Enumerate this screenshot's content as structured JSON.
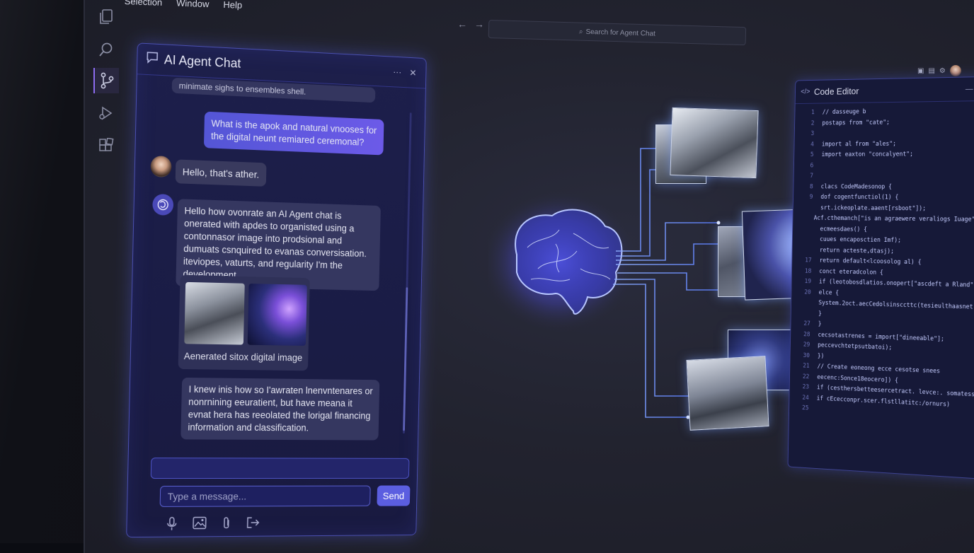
{
  "menubar": {
    "items": [
      "Selection",
      "Window",
      "Help"
    ]
  },
  "search": {
    "placeholder": "Search for Agent Chat"
  },
  "activity_bar": {
    "items": [
      "explorer",
      "search",
      "source-control",
      "run-debug",
      "extensions"
    ]
  },
  "chat": {
    "title": "AI Agent Chat",
    "header_more": "···",
    "header_close": "✕",
    "messages": {
      "cut_top": "minimate sighs to ensembles shell.",
      "user": "What is the apok and natural vnooses for the digital neunt remiared ceremonal?",
      "hello": "Hello, that's ather.",
      "ai1": "Hello how ovonrate an AI Agent chat is onerated with apdes to organisted using a contonnasor image into prodsional and dumuats csnquired to evanas conversisation. iteviopes, vaturts, and regularity I'm the development.",
      "image_caption": "Aenerated sitox digital image",
      "ai2": "I knew inis how so I'awraten lnenvntenares or nonrnining eeuratient, but have meana it evnat hera has reeolated the lorigal financing information and classification."
    },
    "composer": {
      "placeholder": "Type a message...",
      "send_label": "Send",
      "tools": [
        "microphone-icon",
        "image-icon",
        "paperclip-icon",
        "export-icon"
      ]
    }
  },
  "editor": {
    "title": "Code Editor",
    "close": "— ✕",
    "lines": [
      {
        "n": "1",
        "t": "// dasseuge b"
      },
      {
        "n": "2",
        "t": "postaps from \"cate\";"
      },
      {
        "n": "3",
        "t": ""
      },
      {
        "n": "4",
        "t": "import al from \"ales\";"
      },
      {
        "n": "5",
        "t": "import eaxton \"concalyent\";"
      },
      {
        "n": "6",
        "t": ""
      },
      {
        "n": "7",
        "t": ""
      },
      {
        "n": "8",
        "t": "clacs CodeMadesonop {"
      },
      {
        "n": "9",
        "t": "  dof cogentfunctiol(1) {"
      },
      {
        "n": "",
        "t": "    srt.ickeoplate.aaent[rsboot\"]);"
      },
      {
        "n": "",
        "t": "    Acf.cthemanch[\"is an agraewere veraliogs Iuage\"]);"
      },
      {
        "n": "",
        "t": ""
      },
      {
        "n": "",
        "t": ""
      },
      {
        "n": "",
        "t": ""
      },
      {
        "n": "",
        "t": "  ecmeesdaes() {"
      },
      {
        "n": "",
        "t": "    cuues encaposctien Imf);"
      },
      {
        "n": "",
        "t": "    return acteste,dtasj);"
      },
      {
        "n": "",
        "t": ""
      },
      {
        "n": "17",
        "t": "  return default<lcoosolog al) {"
      },
      {
        "n": "18",
        "t": "    conct eteradcolon {"
      },
      {
        "n": "19",
        "t": "      if (leotobosdlatios.onopert[\"ascdeft a Rland\""
      },
      {
        "n": "20",
        "t": "      elce {"
      },
      {
        "n": "",
        "t": "        System.2oct.aecCedolsinsccttc(tesieulthaasnet"
      },
      {
        "n": "",
        "t": "      }"
      },
      {
        "n": "27",
        "t": "    }"
      },
      {
        "n": "28",
        "t": "    cecsotastrenes = import[\"dineeable\"];"
      },
      {
        "n": "29",
        "t": "    peccevchtetpsutbatoi);"
      },
      {
        "n": "30",
        "t": "  })"
      },
      {
        "n": "",
        "t": ""
      },
      {
        "n": "21",
        "t": "  // Create eoneong ecce cesotse snees"
      },
      {
        "n": "22",
        "t": "  eecenc:Sonce18eocero]) {"
      },
      {
        "n": "23",
        "t": "    if (cesthersbetteesercetract. levce:.  somatess"
      },
      {
        "n": "24",
        "t": "      if cEcecconpr.scer.flstllatitc:/ornurs)"
      },
      {
        "n": "25",
        "t": ""
      }
    ]
  },
  "colors": {
    "accent": "#5b5ee0",
    "panel_border": "#4a4fb0",
    "glow": "#6f8cff"
  }
}
